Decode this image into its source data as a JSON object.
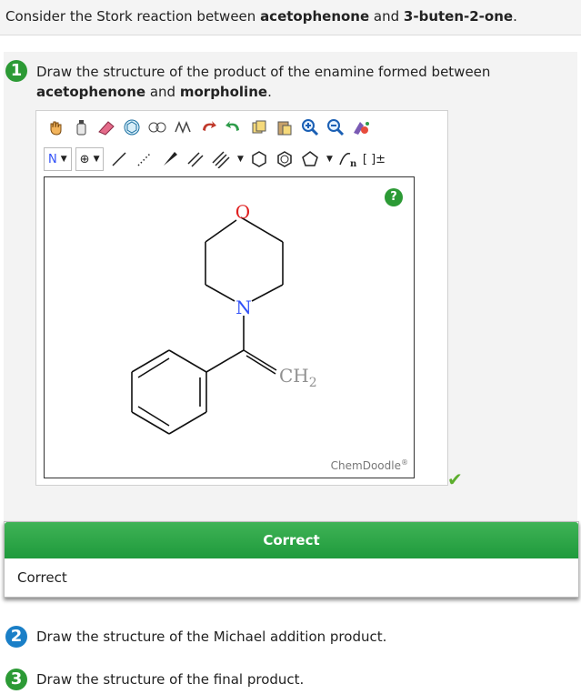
{
  "intro": {
    "prefix": "Consider the Stork reaction between ",
    "reactant1": "acetophenone",
    "mid": " and ",
    "reactant2": "3-buten-2-one",
    "suffix": "."
  },
  "step1": {
    "number": "1",
    "line1": "Draw the structure of the product of the enamine formed between",
    "bold1": "acetophenone",
    "and": " and ",
    "bold2": "morpholine",
    "end": "."
  },
  "editor": {
    "element_select": "N",
    "help": "?",
    "brand": "ChemDoodle",
    "brand_mark": "®",
    "atoms": {
      "oxygen": "O",
      "nitrogen": "N",
      "ch2": "CH",
      "ch2_sub": "2"
    },
    "colors": {
      "oxygen": "#e02020",
      "nitrogen": "#3050f8",
      "ch2": "#909090"
    }
  },
  "feedback": {
    "header": "Correct",
    "message": "Correct"
  },
  "step2": {
    "number": "2",
    "text": "Draw the structure of the Michael addition product."
  },
  "step3": {
    "number": "3",
    "text": "Draw the structure of the final product."
  }
}
